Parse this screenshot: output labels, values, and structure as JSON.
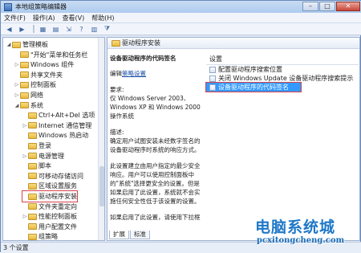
{
  "window": {
    "title": "本地组策略编辑器"
  },
  "menu": [
    "文件(F)",
    "操作(A)",
    "查看(V)",
    "帮助(H)"
  ],
  "tree": {
    "items": [
      {
        "label": "管理模板",
        "level": 1,
        "toggle": "◢"
      },
      {
        "label": "\"开始\"菜单和任务栏",
        "level": 2,
        "toggle": ""
      },
      {
        "label": "Windows 组件",
        "level": 2,
        "toggle": "▷"
      },
      {
        "label": "共享文件夹",
        "level": 2,
        "toggle": ""
      },
      {
        "label": "控制面板",
        "level": 2,
        "toggle": "▷"
      },
      {
        "label": "网络",
        "level": 2,
        "toggle": "▷"
      },
      {
        "label": "系统",
        "level": 2,
        "toggle": "◢"
      },
      {
        "label": "Ctrl+Alt+Del 选项",
        "level": 3,
        "toggle": ""
      },
      {
        "label": "Internet 通信管理",
        "level": 3,
        "toggle": "▷"
      },
      {
        "label": "Windows 热启动",
        "level": 3,
        "toggle": ""
      },
      {
        "label": "登录",
        "level": 3,
        "toggle": ""
      },
      {
        "label": "电源管理",
        "level": 3,
        "toggle": "▷"
      },
      {
        "label": "脚本",
        "level": 3,
        "toggle": ""
      },
      {
        "label": "可移动存储访问",
        "level": 3,
        "toggle": ""
      },
      {
        "label": "区域设置服务",
        "level": 3,
        "toggle": ""
      },
      {
        "label": "驱动程序安装",
        "level": 3,
        "toggle": "",
        "selected": true
      },
      {
        "label": "文件夹重定向",
        "level": 3,
        "toggle": ""
      },
      {
        "label": "性能控制面板",
        "level": 3,
        "toggle": "▷"
      },
      {
        "label": "用户配置文件",
        "level": 3,
        "toggle": ""
      },
      {
        "label": "组策略",
        "level": 3,
        "toggle": ""
      }
    ]
  },
  "right_header": "驱动程序安装",
  "detail": {
    "title": "设备驱动程序的代码签名",
    "edit_prefix": "编辑",
    "edit_link": "策略设置",
    "req_label": "要求:",
    "req_text": "仅 Windows Server 2003、Windows XP 和 Windows 2000 操作系统",
    "desc_label": "描述:",
    "desc_text": "确定用户试图安装未经数字签名的设备驱动程序时系统的响应方式。",
    "desc_more": "此设置建立由用户指定的最少安全响应。用户可以使用控制面板中的\"系统\"选择更安全的设置。但是如果启用了此设置，系统就不会实施任何安全性低于该设置的设置。",
    "desc_tail": "如果启用了此设置，请使用下拉框"
  },
  "settings": {
    "column": "设置",
    "items": [
      {
        "label": "配置驱动程序搜索位置",
        "highlighted": false
      },
      {
        "label": "关闭 Windows Update 设备驱动程序搜索提示",
        "highlighted": false
      },
      {
        "label": "设备驱动程序的代码签名",
        "highlighted": true
      }
    ]
  },
  "tabs": [
    {
      "label": "扩展",
      "active": true
    },
    {
      "label": "标准",
      "active": false
    }
  ],
  "status": "3 个设置",
  "watermark": {
    "cn": "电脑系统城",
    "en": "pcxitongcheng.com"
  },
  "colors": {
    "selection": "#3399ff",
    "highlight_border": "#d8434c",
    "logo": "#1e78c8"
  }
}
